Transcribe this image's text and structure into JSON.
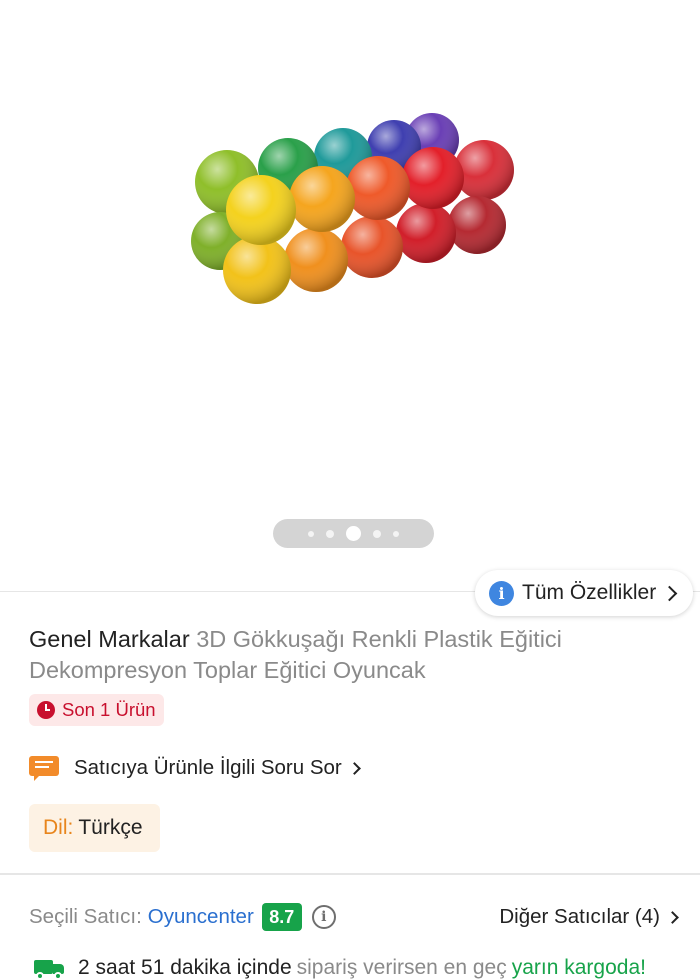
{
  "gallery": {
    "image_alt": "3D rainbow plastic balls toy",
    "page_count": 5,
    "active_index": 2
  },
  "specs_button": {
    "label": "Tüm Özellikler"
  },
  "product": {
    "brand": "Genel Markalar",
    "name": "3D Gökkuşağı Renkli Plastik Eğitici Dekompresyon Toplar Eğitici Oyuncak"
  },
  "stock_badge": {
    "text": "Son 1 Ürün"
  },
  "ask_seller": {
    "label": "Satıcıya Ürünle İlgili Soru Sor"
  },
  "language": {
    "key": "Dil:",
    "value": "Türkçe"
  },
  "seller": {
    "key": "Seçili Satıcı:",
    "name": "Oyuncenter",
    "score": "8.7",
    "other_sellers": "Diğer Satıcılar (4)"
  },
  "delivery": {
    "part1": "2 saat 51 dakika içinde",
    "part2": "sipariş verirsen en geç",
    "part3": "yarın kargoda!"
  },
  "colors": {
    "accent_blue": "#3f86e0",
    "seller_link": "#2a6fcf",
    "success_green": "#17a34a",
    "stock_red": "#c8102e",
    "warning_orange": "#f28b2a"
  }
}
